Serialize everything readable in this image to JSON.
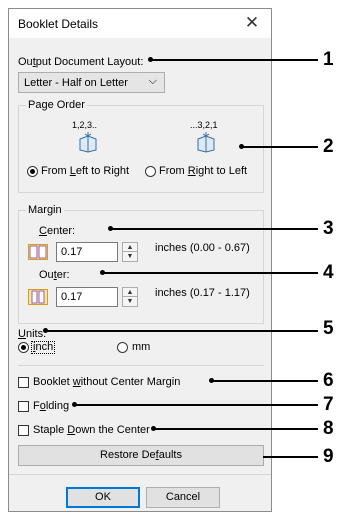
{
  "window": {
    "title": "Booklet Details",
    "close_glyph": "✕"
  },
  "output_layout": {
    "label_pre": "Ou",
    "label_key": "t",
    "label_post": "put Document Layout:",
    "selected": "Letter - Half on Letter",
    "chevron_glyph": "⌵"
  },
  "page_order": {
    "group_label": "Page Order",
    "ltr_caption": "1,2,3..",
    "rtl_caption": "...3,2,1",
    "ltr_pre": "From ",
    "ltr_key": "L",
    "ltr_post": "eft to Right",
    "rtl_pre": "From ",
    "rtl_key": "R",
    "rtl_post": "ight to Left",
    "selected": "ltr"
  },
  "margin": {
    "group_label": "Margin",
    "center_key": "C",
    "center_post": "enter:",
    "center_value": "0.17",
    "center_range": "inches (0.00 - 0.67)",
    "outer_pre": "Ou",
    "outer_key": "t",
    "outer_post": "er:",
    "outer_value": "0.17",
    "outer_range": "inches (0.17 - 1.17)",
    "spin_up": "▲",
    "spin_down": "▼"
  },
  "units": {
    "label_key": "U",
    "label_post": "nits:",
    "inch_key": "i",
    "inch_post": "nch",
    "mm_label": "mm",
    "selected": "inch"
  },
  "options": {
    "booklet_pre": "Booklet ",
    "booklet_key": "w",
    "booklet_post": "ithout Center Margin",
    "folding_pre": "F",
    "folding_key": "o",
    "folding_post": "lding",
    "staple_pre": "Staple ",
    "staple_key": "D",
    "staple_post": "own the Center"
  },
  "buttons": {
    "restore_pre": "Restore De",
    "restore_key": "f",
    "restore_post": "aults",
    "ok": "OK",
    "cancel": "Cancel"
  },
  "callouts": [
    "1",
    "2",
    "3",
    "4",
    "5",
    "6",
    "7",
    "8",
    "9"
  ]
}
